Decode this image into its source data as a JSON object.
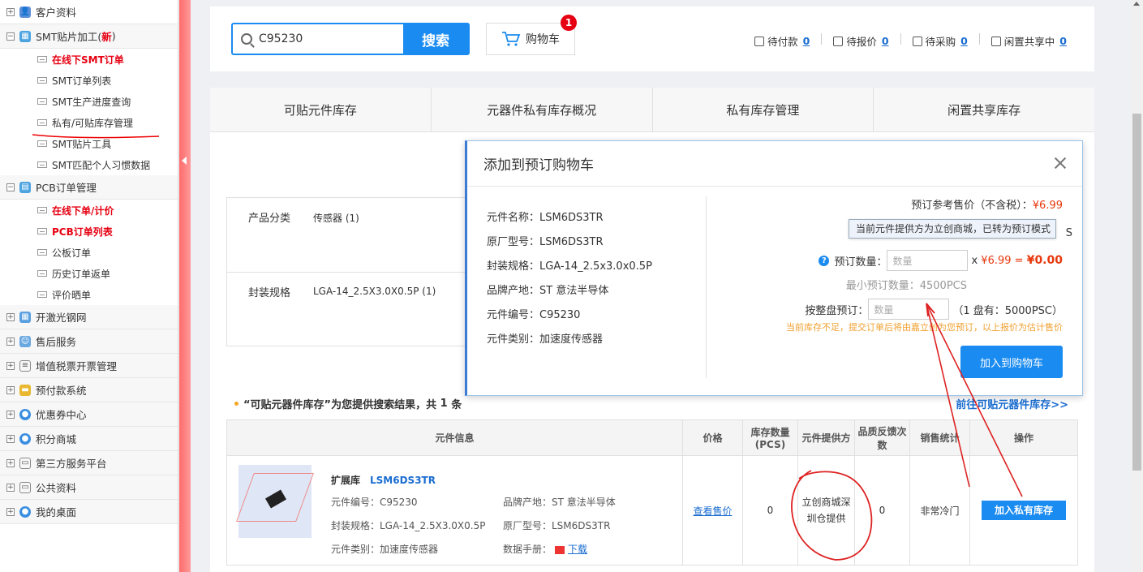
{
  "sidebar": {
    "groups": [
      {
        "label": "客户资料"
      },
      {
        "label": "SMT贴片加工(",
        "suffix": "新",
        "suffix_close": ")"
      },
      {
        "label": "PCB订单管理"
      },
      {
        "label": "开激光钢网"
      },
      {
        "label": "售后服务"
      },
      {
        "label": "增值税票开票管理"
      },
      {
        "label": "预付款系统"
      },
      {
        "label": "优惠券中心"
      },
      {
        "label": "积分商城"
      },
      {
        "label": "第三方服务平台"
      },
      {
        "label": "公共资料"
      },
      {
        "label": "我的桌面"
      }
    ],
    "smt_items": [
      "在线下SMT订单",
      "SMT订单列表",
      "SMT生产进度查询",
      "私有/可贴库存管理",
      "SMT贴片工具",
      "SMT匹配个人习惯数据"
    ],
    "pcb_items": [
      "在线下单/计价",
      "PCB订单列表",
      "公板订单",
      "历史订单返单",
      "评价晒单"
    ]
  },
  "search": {
    "value": "C95230",
    "button": "搜索"
  },
  "cart": {
    "label": "购物车",
    "badge": "1"
  },
  "status": [
    {
      "label": "待付款",
      "count": "0"
    },
    {
      "label": "待报价",
      "count": "0"
    },
    {
      "label": "待采购",
      "count": "0"
    },
    {
      "label": "闲置共享中",
      "count": "0"
    }
  ],
  "tabs": [
    "可贴元件库存",
    "元器件私有库存概况",
    "私有库存管理",
    "闲置共享库存"
  ],
  "filter": {
    "category_label": "产品分类",
    "category_value": "传感器 (1)",
    "package_label": "封装规格",
    "package_value": "LGA-14_2.5X3.0X0.5P (1)"
  },
  "results": {
    "title": "“可贴元器件库存”为您提供搜索结果，共",
    "count": "1",
    "unit": "条",
    "goto": "前往可贴元器件库存>>"
  },
  "table": {
    "headers": [
      "元件信息",
      "价格",
      "库存数量(PCS)",
      "元件提供方",
      "品质反馈次数",
      "销售统计",
      "操作"
    ],
    "row": {
      "tag": "扩展库",
      "name": "LSM6DS3TR",
      "code": "元件编号：C95230",
      "brand": "品牌产地：ST 意法半导体",
      "package": "封装规格：LGA-14_2.5X3.0X0.5P",
      "model": "原厂型号：LSM6DS3TR",
      "category": "元件类别：加速度传感器",
      "datasheet_label": "数据手册：",
      "datasheet_link": "下载",
      "price": "查看售价",
      "stock": "0",
      "provider": "立创商城深圳仓提供",
      "feedback": "0",
      "sales": "非常冷门",
      "action": "加入私有库存"
    }
  },
  "modal": {
    "title": "添加到预订购物车",
    "info": [
      "元件名称：LSM6DS3TR",
      "原厂型号：LSM6DS3TR",
      "封装规格：LGA-14_2.5x3.0x0.5P",
      "品牌产地：ST 意法半导体",
      "元件编号：C95230",
      "元件类别：加速度传感器"
    ],
    "ref_price_label": "预订参考售价（不含税）：",
    "ref_price": "¥6.99",
    "tooltip": "当前元件提供方为立创商城，已转为预订模式",
    "tip_cut": "S",
    "qty_label": "预订数量：",
    "qty_placeholder": "数量",
    "qty_mult": "x",
    "qty_price": "¥6.99",
    "qty_eq": "=",
    "qty_total": "¥0.00",
    "min_qty": "最小预订数量：4500PCS",
    "reel_label": "按整盘预订：",
    "reel_placeholder": "数量",
    "reel_info": "（1 盘有：5000PSC）",
    "warning": "当前库存不足，提交订单后将由嘉立创为您预订，以上报价为估计售价",
    "add_button": "加入到购物车"
  },
  "colors": {
    "accent": "#1a8bf0",
    "red": "#e60012",
    "price": "#e8380d"
  }
}
